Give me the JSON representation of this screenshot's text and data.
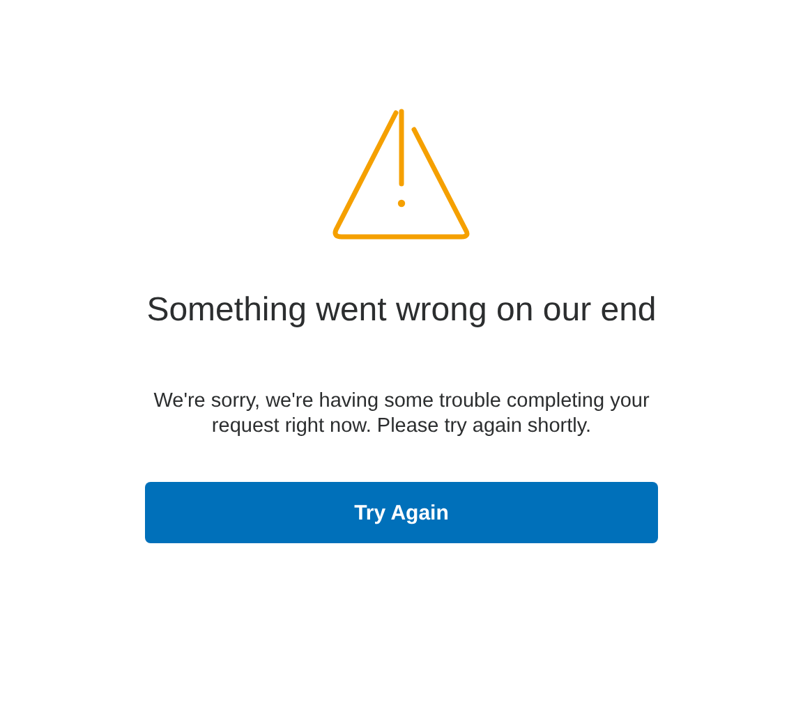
{
  "heading": "Something went wrong on our end",
  "message": "We're sorry, we're having some trouble completing your request right now. Please try again shortly.",
  "button": {
    "label": "Try Again"
  }
}
